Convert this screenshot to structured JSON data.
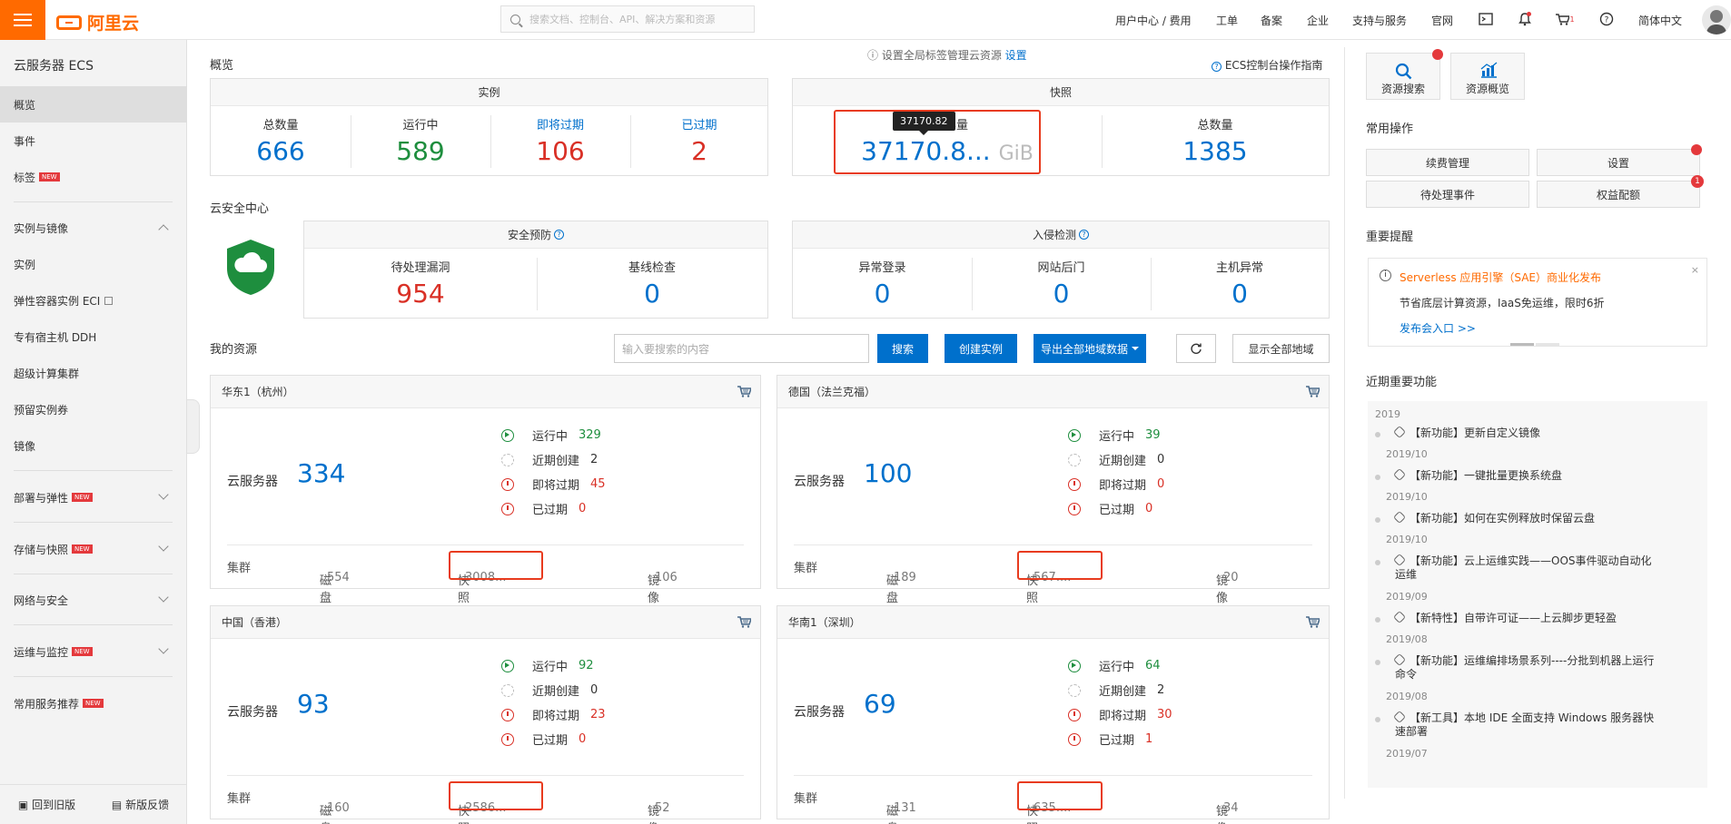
{
  "topbar": {
    "logo_text": "阿里云",
    "search_placeholder": "搜索文档、控制台、API、解决方案和资源",
    "nav": [
      "用户中心 / 费用",
      "工单",
      "备案",
      "企业",
      "支持与服务",
      "官网"
    ],
    "cart_count": "1",
    "language": "简体中文"
  },
  "sidebar": {
    "title": "云服务器 ECS",
    "items": [
      "概览",
      "事件",
      "标签",
      "实例与镜像",
      "实例",
      "弹性容器实例 ECI",
      "专有宿主机 DDH",
      "超级计算集群",
      "预留实例券",
      "镜像",
      "部署与弹性",
      "存储与快照",
      "网络与安全",
      "运维与监控",
      "常用服务推荐"
    ],
    "new_badge": "NEW",
    "footer": [
      "回到旧版",
      "新版反馈"
    ]
  },
  "overview": {
    "title": "概览",
    "notice_text": "设置全局标签管理云资源",
    "notice_link": "设置",
    "guide_link": "ECS控制台操作指南",
    "instances": {
      "header": "实例",
      "total_label": "总数量",
      "total": "666",
      "running_label": "运行中",
      "running": "589",
      "expiring_label": "即将过期",
      "expiring": "106",
      "expired_label": "已过期",
      "expired": "2"
    },
    "snapshot": {
      "header": "快照",
      "capacity_label": "容量",
      "capacity": "37170.8...",
      "unit": "GiB",
      "tooltip": "37170.82",
      "total_label": "总数量",
      "total": "1385"
    }
  },
  "security": {
    "title": "云安全中心",
    "prevention": {
      "header": "安全预防",
      "vuln_label": "待处理漏洞",
      "vuln": "954",
      "baseline_label": "基线检查",
      "baseline": "0"
    },
    "intrusion": {
      "header": "入侵检测",
      "login_label": "异常登录",
      "login": "0",
      "backdoor_label": "网站后门",
      "backdoor": "0",
      "host_label": "主机异常",
      "host": "0"
    }
  },
  "resources": {
    "title": "我的资源",
    "search_placeholder": "输入要搜索的内容",
    "search_btn": "搜索",
    "create_btn": "创建实例",
    "export_btn": "导出全部地域数据",
    "show_all_btn": "显示全部地域",
    "labels": {
      "ecs": "云服务器",
      "running": "运行中",
      "recent": "近期创建",
      "expiring": "即将过期",
      "expired": "已过期",
      "cluster": "集群",
      "disk": "磁盘",
      "snapshot": "快照",
      "image": "镜像"
    },
    "regions": [
      {
        "name": "华东1（杭州）",
        "ecs": "334",
        "running": "329",
        "recent": "2",
        "expiring": "45",
        "expired": "0",
        "disk": "554",
        "snapshot": "3008...",
        "image": "106"
      },
      {
        "name": "德国（法兰克福）",
        "ecs": "100",
        "running": "39",
        "recent": "0",
        "expiring": "0",
        "expired": "0",
        "disk": "189",
        "snapshot": "567....",
        "image": "20"
      },
      {
        "name": "中国（香港）",
        "ecs": "93",
        "running": "92",
        "recent": "0",
        "expiring": "23",
        "expired": "0",
        "disk": "160",
        "snapshot": "2586...",
        "image": "52"
      },
      {
        "name": "华南1（深圳）",
        "ecs": "69",
        "running": "64",
        "recent": "2",
        "expiring": "30",
        "expired": "1",
        "disk": "131",
        "snapshot": "635....",
        "image": "34"
      }
    ]
  },
  "right_panel": {
    "resource_search": "资源搜索",
    "resource_overview": "资源概览",
    "common_ops_title": "常用操作",
    "ops": [
      "续费管理",
      "设置",
      "待处理事件",
      "权益配额"
    ],
    "ops_badge": "1",
    "reminder_title": "重要提醒",
    "alert_title": "Serverless 应用引擎（SAE）商业化发布",
    "alert_body": "节省底层计算资源，IaaS免运维，限时6折",
    "alert_link": "发布会入口 >>",
    "features_title": "近期重要功能",
    "features_year": "2019",
    "features": [
      {
        "text": "【新功能】更新自定义镜像",
        "date": "2019/10"
      },
      {
        "text": "【新功能】一键批量更换系统盘",
        "date": "2019/10"
      },
      {
        "text": "【新功能】如何在实例释放时保留云盘",
        "date": "2019/10"
      },
      {
        "text": "【新功能】云上运维实践——OOS事件驱动自动化运维",
        "date": "2019/09"
      },
      {
        "text": "【新特性】自带许可证——上云脚步更轻盈",
        "date": "2019/08"
      },
      {
        "text": "【新功能】运维编排场景系列----分批到机器上运行命令",
        "date": "2019/08"
      },
      {
        "text": "【新工具】本地 IDE 全面支持 Windows 服务器快速部署",
        "date": "2019/07"
      }
    ]
  },
  "colors": {
    "brand": "#ff6a00",
    "primary": "#0070cc",
    "running": "#1e8e3e",
    "danger": "#d93026",
    "highlight": "#e83b1e"
  }
}
